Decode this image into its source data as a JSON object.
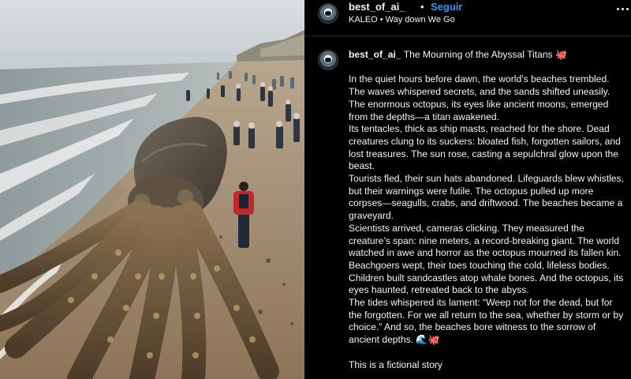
{
  "post": {
    "username": "best_of_ai_",
    "separator": "•",
    "follow_label": "Seguir",
    "audio": "KALEO • Way down We Go"
  },
  "caption": {
    "username": "best_of_ai_",
    "title": "The Mourning of the Abyssal Titans",
    "title_emoji": "🐙",
    "paragraphs": [
      "In the quiet hours before dawn, the world’s beaches trembled. The waves whispered secrets, and the sands shifted uneasily. The enormous octopus, its eyes like ancient moons, emerged from the depths—a titan awakened.",
      "Its tentacles, thick as ship masts, reached for the shore. Dead creatures clung to its suckers: bloated fish, forgotten sailors, and lost treasures. The sun rose, casting a sepulchral glow upon the beast.",
      "Tourists fled, their sun hats abandoned. Lifeguards blew whistles, but their warnings were futile. The octopus pulled up more corpses—seagulls, crabs, and driftwood. The beaches became a graveyard.",
      "Scientists arrived, cameras clicking. They measured the creature’s span: nine meters, a record-breaking giant. The world watched in awe and horror as the octopus mourned its fallen kin.",
      "Beachgoers wept, their toes touching the cold, lifeless bodies. Children built sandcastles atop whale bones. And the octopus, its eyes haunted, retreated back to the abyss."
    ],
    "last_paragraph": "The tides whispered its lament: “Weep not for the dead, but for the forgotten. For we all return to the sea, whether by storm or by choice.” And so, the beaches bore witness to the sorrow of ancient depths.",
    "last_emojis": "🌊🐙",
    "footer": "This is a fictional story"
  },
  "icons": {
    "avatar": "astronaut-avatar-icon",
    "more": "more-options-icon"
  }
}
